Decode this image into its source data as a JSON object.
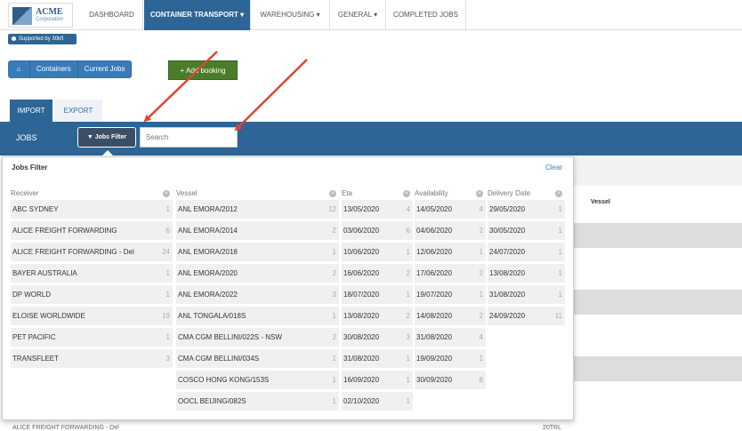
{
  "nav": {
    "logo_title": "ACME",
    "logo_subtitle": "Corporation",
    "items": [
      "DASHBOARD",
      "CONTAINER TRANSPORT ▾",
      "WAREHOUSING ▾",
      "GENERAL ▾",
      "COMPLETED JOBS"
    ],
    "supported": "Supported by 30kft"
  },
  "breadcrumb": {
    "items": [
      "Containers",
      "Current Jobs"
    ]
  },
  "add_booking": "+ Add booking",
  "tabs": {
    "import": "IMPORT",
    "export": "EXPORT"
  },
  "jobs": {
    "label": "JOBS",
    "filter_button": "Jobs Filter",
    "search_placeholder": "Search"
  },
  "background": {
    "vessel_header": "Vessel",
    "bottom_left": "ALICE FREIGHT FORWARDING - Del",
    "bottom_right": "20TRL"
  },
  "filter": {
    "title": "Jobs Filter",
    "clear": "Clear",
    "columns": [
      {
        "header": "Receiver",
        "items": [
          {
            "label": "ABC SYDNEY",
            "count": "1"
          },
          {
            "label": "ALICE FREIGHT FORWARDING",
            "count": "6"
          },
          {
            "label": "ALICE FREIGHT FORWARDING - Del",
            "count": "24"
          },
          {
            "label": "BAYER AUSTRALIA",
            "count": "1"
          },
          {
            "label": "DP WORLD",
            "count": "1"
          },
          {
            "label": "ELOISE WORLDWIDE",
            "count": "19"
          },
          {
            "label": "PET PACIFIC",
            "count": "1"
          },
          {
            "label": "TRANSFLEET",
            "count": "3"
          }
        ]
      },
      {
        "header": "Vessel",
        "items": [
          {
            "label": "ANL EMORA/2012",
            "count": "12"
          },
          {
            "label": "ANL EMORA/2014",
            "count": "2"
          },
          {
            "label": "ANL EMORA/2018",
            "count": "1"
          },
          {
            "label": "ANL EMORA/2020",
            "count": "2"
          },
          {
            "label": "ANL EMORA/2022",
            "count": "3"
          },
          {
            "label": "ANL TONGALA/018S",
            "count": "1"
          },
          {
            "label": "CMA CGM BELLINI/022S - NSW",
            "count": "2"
          },
          {
            "label": "CMA CGM BELLINI/034S",
            "count": "1"
          },
          {
            "label": "COSCO HONG KONG/153S",
            "count": "1"
          },
          {
            "label": "OOCL BEIJING/082S",
            "count": "1"
          }
        ]
      },
      {
        "header": "Eta",
        "items": [
          {
            "label": "13/05/2020",
            "count": "4"
          },
          {
            "label": "03/06/2020",
            "count": "6"
          },
          {
            "label": "10/06/2020",
            "count": "1"
          },
          {
            "label": "16/06/2020",
            "count": "2"
          },
          {
            "label": "18/07/2020",
            "count": "1"
          },
          {
            "label": "13/08/2020",
            "count": "2"
          },
          {
            "label": "30/08/2020",
            "count": "3"
          },
          {
            "label": "31/08/2020",
            "count": "1"
          },
          {
            "label": "16/09/2020",
            "count": "1"
          },
          {
            "label": "02/10/2020",
            "count": "1"
          }
        ]
      },
      {
        "header": "Availability",
        "items": [
          {
            "label": "14/05/2020",
            "count": "4"
          },
          {
            "label": "04/06/2020",
            "count": "2"
          },
          {
            "label": "12/06/2020",
            "count": "1"
          },
          {
            "label": "17/06/2020",
            "count": "2"
          },
          {
            "label": "19/07/2020",
            "count": "1"
          },
          {
            "label": "14/08/2020",
            "count": "2"
          },
          {
            "label": "31/08/2020",
            "count": "4"
          },
          {
            "label": "19/09/2020",
            "count": "1"
          },
          {
            "label": "30/09/2020",
            "count": "8"
          }
        ]
      },
      {
        "header": "Delivery Date",
        "items": [
          {
            "label": "29/05/2020",
            "count": "1"
          },
          {
            "label": "30/05/2020",
            "count": "1"
          },
          {
            "label": "24/07/2020",
            "count": "1"
          },
          {
            "label": "13/08/2020",
            "count": "1"
          },
          {
            "label": "31/08/2020",
            "count": "1"
          },
          {
            "label": "24/09/2020",
            "count": "11"
          }
        ]
      }
    ]
  },
  "colors": {
    "primary": "#2d6596",
    "accent_green": "#4a7d2a",
    "arrow": "#e0452f"
  }
}
